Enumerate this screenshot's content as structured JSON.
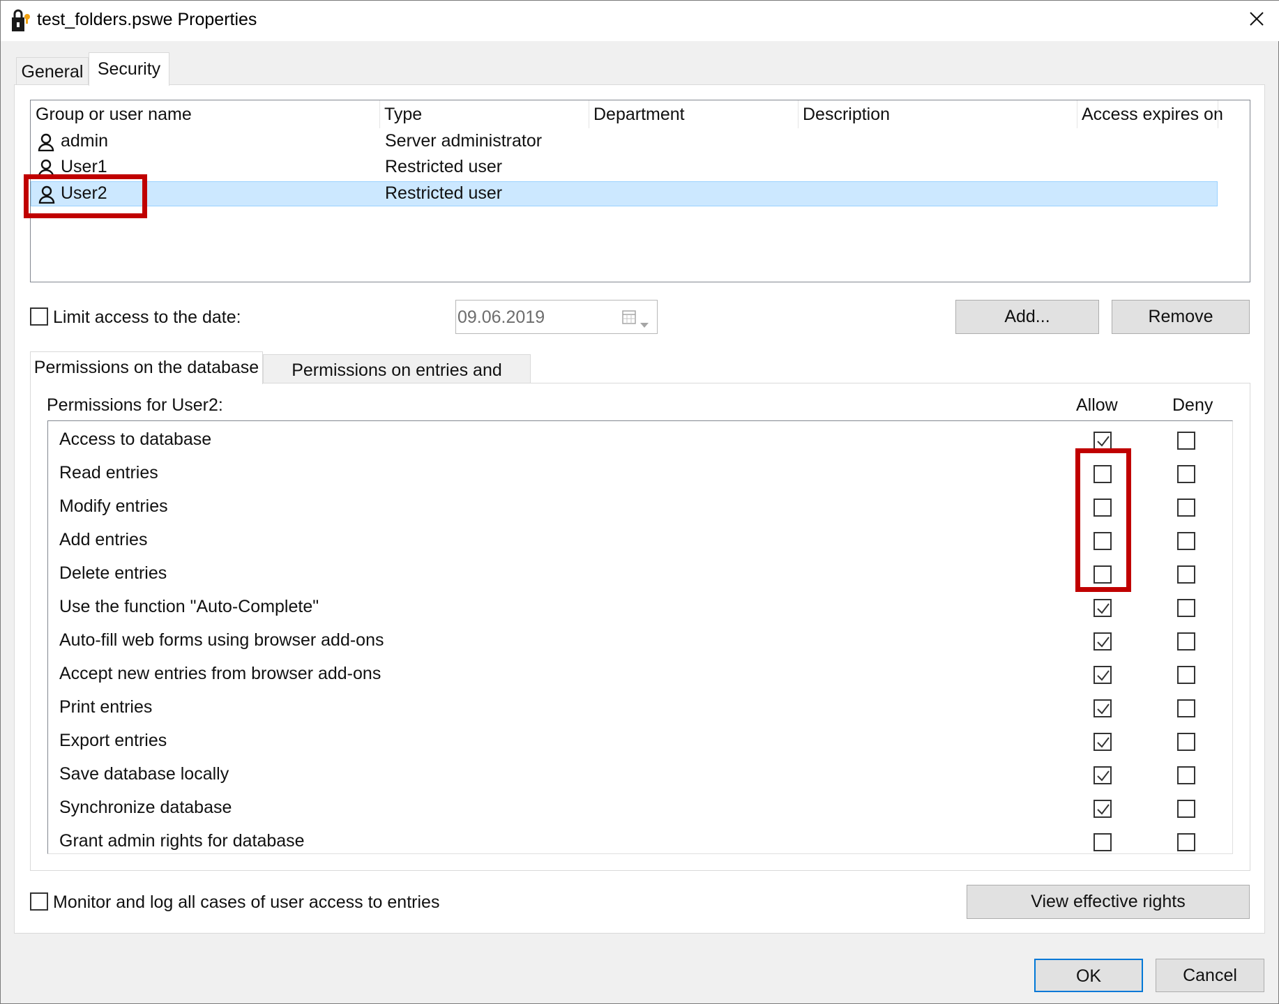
{
  "window": {
    "title": "test_folders.pswe Properties"
  },
  "tabs": [
    {
      "label": "General"
    },
    {
      "label": "Security"
    }
  ],
  "users_list": {
    "columns": [
      "Group or user name",
      "Type",
      "Department",
      "Description",
      "Access expires on"
    ],
    "rows": [
      {
        "name": "admin",
        "type": "Server administrator",
        "selected": false
      },
      {
        "name": "User1",
        "type": "Restricted user",
        "selected": false
      },
      {
        "name": "User2",
        "type": "Restricted user",
        "selected": true
      }
    ]
  },
  "limit_access": {
    "label": "Limit access to the date:",
    "checked": false,
    "date": "09.06.2019"
  },
  "buttons": {
    "add": "Add...",
    "remove": "Remove",
    "view_rights": "View effective rights",
    "ok": "OK",
    "cancel": "Cancel"
  },
  "perm_tabs": [
    {
      "label": "Permissions on the database"
    },
    {
      "label": "Permissions on entries and folders"
    }
  ],
  "permissions": {
    "title": "Permissions for User2:",
    "allow_header": "Allow",
    "deny_header": "Deny",
    "items": [
      {
        "label": "Access to database",
        "allow": true,
        "deny": false
      },
      {
        "label": "Read entries",
        "allow": false,
        "deny": false
      },
      {
        "label": "Modify entries",
        "allow": false,
        "deny": false
      },
      {
        "label": "Add entries",
        "allow": false,
        "deny": false
      },
      {
        "label": "Delete entries",
        "allow": false,
        "deny": false
      },
      {
        "label": "Use the function \"Auto-Complete\"",
        "allow": true,
        "deny": false
      },
      {
        "label": "Auto-fill web forms using browser add-ons",
        "allow": true,
        "deny": false
      },
      {
        "label": "Accept new entries from browser add-ons",
        "allow": true,
        "deny": false
      },
      {
        "label": "Print entries",
        "allow": true,
        "deny": false
      },
      {
        "label": "Export entries",
        "allow": true,
        "deny": false
      },
      {
        "label": "Save database locally",
        "allow": true,
        "deny": false
      },
      {
        "label": "Synchronize database",
        "allow": true,
        "deny": false
      },
      {
        "label": "Grant admin rights for database",
        "allow": false,
        "deny": false
      }
    ]
  },
  "monitor": {
    "label": "Monitor and log all cases of user access to entries",
    "checked": false
  },
  "colors": {
    "selection": "#cce8ff",
    "highlight": "#c00000"
  }
}
